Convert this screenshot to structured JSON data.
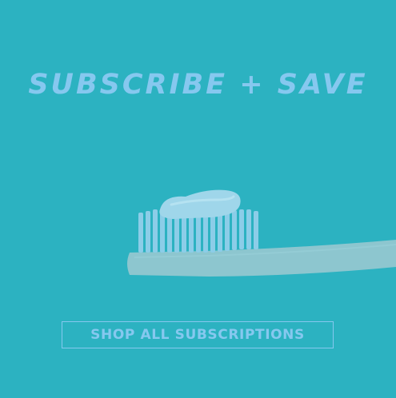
{
  "banner": {
    "headline": "SUBSCRIBE + SAVE",
    "cta_label": "SHOP ALL SUBSCRIPTIONS"
  },
  "colors": {
    "background": "#2cb2c1",
    "text_accent": "#86c8ef",
    "toothpaste": "#9fd6ea",
    "bristles": "#8ccde8",
    "handle": "#8dc6cf"
  },
  "icons": {
    "hero_image": "toothbrush-with-toothpaste"
  }
}
